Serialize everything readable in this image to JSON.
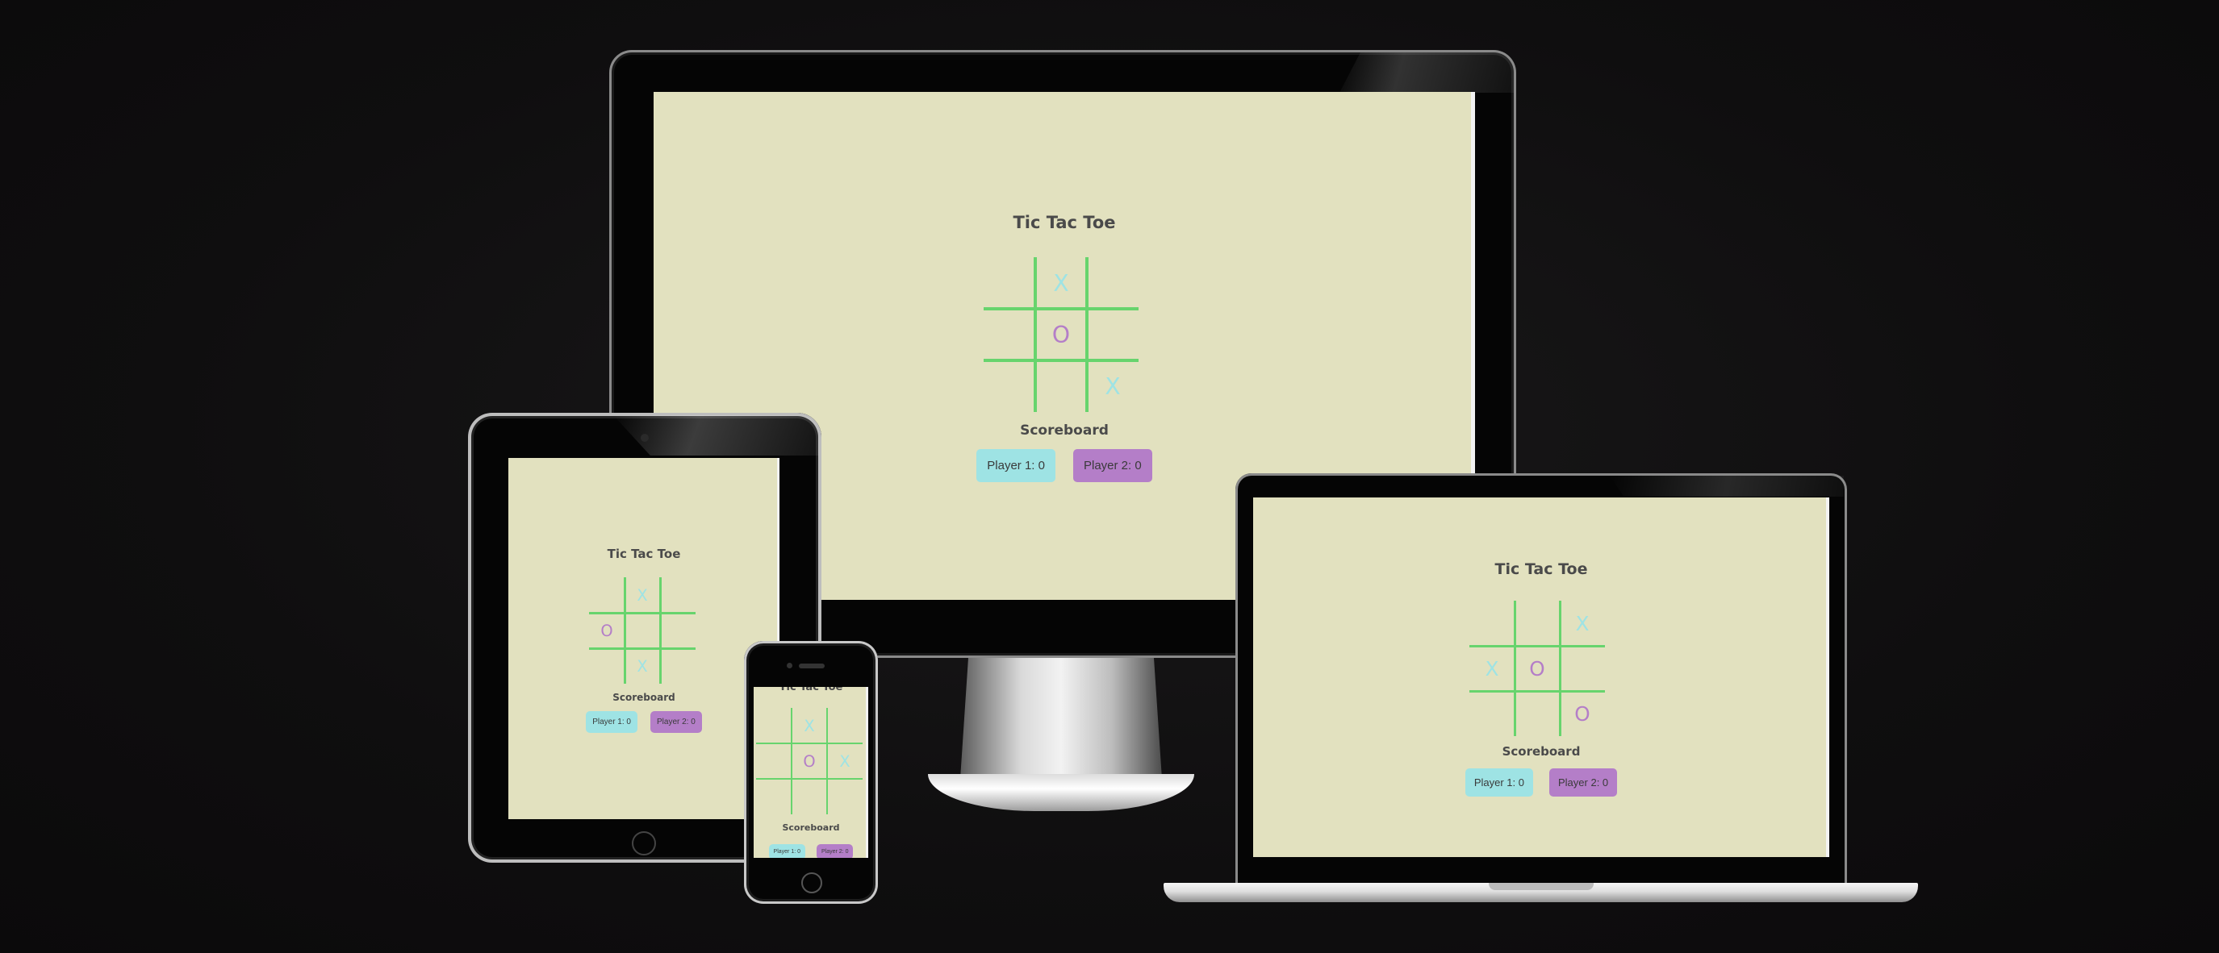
{
  "page_title": "Tic Tac Toe",
  "scoreboard_label": "Scoreboard",
  "player1_label": "Player 1: 0",
  "player2_label": "Player 2: 0",
  "colors": {
    "background": "#0f0e0f",
    "screen": "#e2e1bf",
    "grid": "#67d46d",
    "mark_x": "#9ee3e4",
    "mark_o": "#b47ec8",
    "player1_button": "#9ee3e4",
    "player2_button": "#b47ec8"
  },
  "boards": {
    "monitor": [
      "",
      "X",
      "",
      "",
      "O",
      "",
      "",
      "",
      "X"
    ],
    "tablet": [
      "",
      "X",
      "",
      "O",
      "",
      "",
      "",
      "X",
      ""
    ],
    "phone": [
      "",
      "X",
      "",
      "",
      "O",
      "X",
      "",
      "",
      ""
    ],
    "laptop": [
      "",
      "",
      "X",
      "X",
      "O",
      "",
      "",
      "",
      "O"
    ]
  }
}
